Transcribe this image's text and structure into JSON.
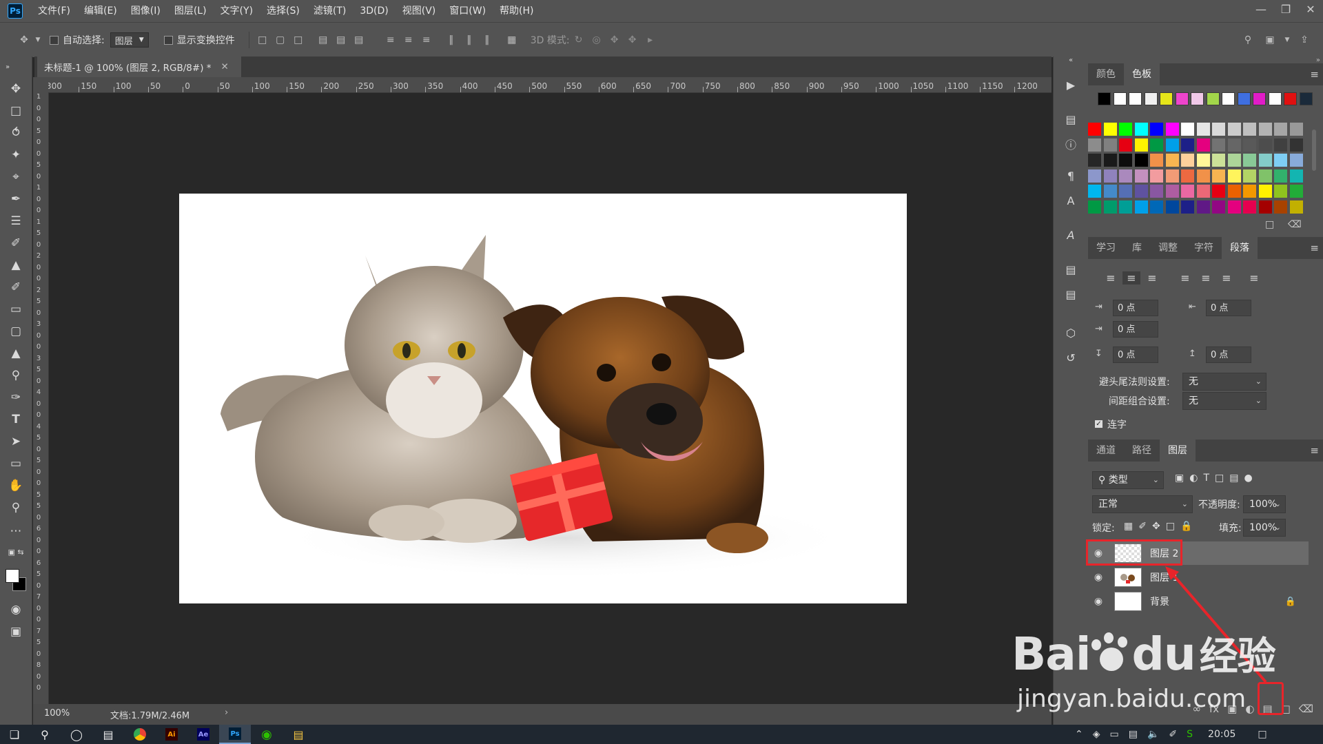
{
  "app": {
    "logo": "Ps"
  },
  "menu": [
    "文件(F)",
    "编辑(E)",
    "图像(I)",
    "图层(L)",
    "文字(Y)",
    "选择(S)",
    "滤镜(T)",
    "3D(D)",
    "视图(V)",
    "窗口(W)",
    "帮助(H)"
  ],
  "options": {
    "auto_select_label": "自动选择:",
    "auto_select_value": "图层",
    "show_transform_label": "显示变换控件",
    "mode_3d_label": "3D 模式:"
  },
  "document": {
    "tab_title": "未标题-1 @ 100% (图层 2, RGB/8#) *",
    "zoom": "100%",
    "doc_info": "文档:1.79M/2.46M"
  },
  "ruler_h": [
    "300",
    "150",
    "100",
    "50",
    "0",
    "50",
    "100",
    "150",
    "200",
    "250",
    "300",
    "350",
    "400",
    "450",
    "500",
    "550",
    "600",
    "650",
    "700",
    "750",
    "800",
    "850",
    "900",
    "950",
    "1000",
    "1050",
    "1100",
    "1150",
    "1200"
  ],
  "ruler_v": [
    "1",
    "0",
    "0",
    "5",
    "0",
    "0",
    "5",
    "0",
    "1",
    "0",
    "0",
    "1",
    "5",
    "0",
    "2",
    "0",
    "0",
    "2",
    "5",
    "0",
    "3",
    "0",
    "0",
    "3",
    "5",
    "0",
    "4",
    "0",
    "0",
    "4",
    "5",
    "0",
    "5",
    "0",
    "0",
    "5",
    "5",
    "0",
    "6",
    "0",
    "0",
    "6",
    "5",
    "0",
    "7",
    "0",
    "0",
    "7",
    "5",
    "0",
    "8",
    "0",
    "0"
  ],
  "swatch_panel": {
    "tabs": [
      "颜色",
      "色板"
    ],
    "active": "色板",
    "recent": [
      "#000000",
      "#ffffff",
      "#ffffff",
      "#f0f0f0",
      "#e5e51a",
      "#ee44cc",
      "#f0c8e8",
      "#a2d64a",
      "#ffffff",
      "#3f6fe0",
      "#e21cc8",
      "#ffffff",
      "#e01010",
      "#1a2a3a"
    ],
    "grid": [
      [
        "#ff0000",
        "#ffff00",
        "#00ff00",
        "#00ffff",
        "#0000ff",
        "#ff00ff",
        "#ffffff",
        "#e6e6e6",
        "#d9d9d9",
        "#cccccc",
        "#bfbfbf",
        "#b3b3b3",
        "#a6a6a6",
        "#999999"
      ],
      [
        "#8c8c8c",
        "#808080",
        "#e60012",
        "#fff100",
        "#009944",
        "#00a0e9",
        "#1d2088",
        "#e4007f",
        "#737373",
        "#666666",
        "#595959",
        "#4d4d4d",
        "#404040",
        "#333333"
      ],
      [
        "#262626",
        "#1a1a1a",
        "#0d0d0d",
        "#000000",
        "#f19149",
        "#f8b551",
        "#fdd09b",
        "#fff799",
        "#cce198",
        "#acd598",
        "#89c997",
        "#84ccc9",
        "#7ecef4",
        "#88abda"
      ],
      [
        "#8c97cb",
        "#8f82bc",
        "#aa89bd",
        "#c490bf",
        "#f29c9f",
        "#f29b76",
        "#ec6941",
        "#f19149",
        "#f8b551",
        "#fff45c",
        "#b3d465",
        "#80c269",
        "#32b16c",
        "#13b5b1"
      ],
      [
        "#00b7ee",
        "#448aca",
        "#556fb5",
        "#5f52a0",
        "#8957a1",
        "#ae5da1",
        "#ea68a2",
        "#eb6877",
        "#e60012",
        "#eb6100",
        "#f39800",
        "#fff100",
        "#8fc31f",
        "#22ac38"
      ],
      [
        "#009944",
        "#009b6b",
        "#009e96",
        "#00a0e9",
        "#0068b7",
        "#00479d",
        "#1d2088",
        "#601986",
        "#920783",
        "#e4007f",
        "#e5004f",
        "#a40000",
        "#a84200",
        "#c2b000"
      ]
    ]
  },
  "paragraph_panel": {
    "tabs": [
      "学习",
      "库",
      "调整",
      "字符",
      "段落"
    ],
    "active": "段落",
    "indent_left": "0 点",
    "indent_right": "0 点",
    "indent_first": "0 点",
    "space_before": "0 点",
    "space_after": "0 点",
    "kinsoku_label": "避头尾法则设置:",
    "kinsoku_value": "无",
    "mojikumi_label": "间距组合设置:",
    "mojikumi_value": "无",
    "hyphenate_label": "连字"
  },
  "layers_panel": {
    "tabs": [
      "通道",
      "路径",
      "图层"
    ],
    "active": "图层",
    "filter_label": "类型",
    "blend_mode": "正常",
    "opacity_label": "不透明度:",
    "opacity_value": "100%",
    "lock_label": "锁定:",
    "fill_label": "填充:",
    "fill_value": "100%",
    "layers": [
      {
        "name": "图层 2",
        "selected": true
      },
      {
        "name": "图层 1",
        "selected": false
      },
      {
        "name": "背景",
        "selected": false
      }
    ]
  },
  "watermark": {
    "line1_a": "Bai",
    "line1_b": "du",
    "line1_c": "经验",
    "line2": "jingyan.baidu.com"
  },
  "taskbar": {
    "time": "20:05"
  },
  "colors": {
    "highlight": "#e8242a",
    "ps_blue": "#31a8ff"
  }
}
